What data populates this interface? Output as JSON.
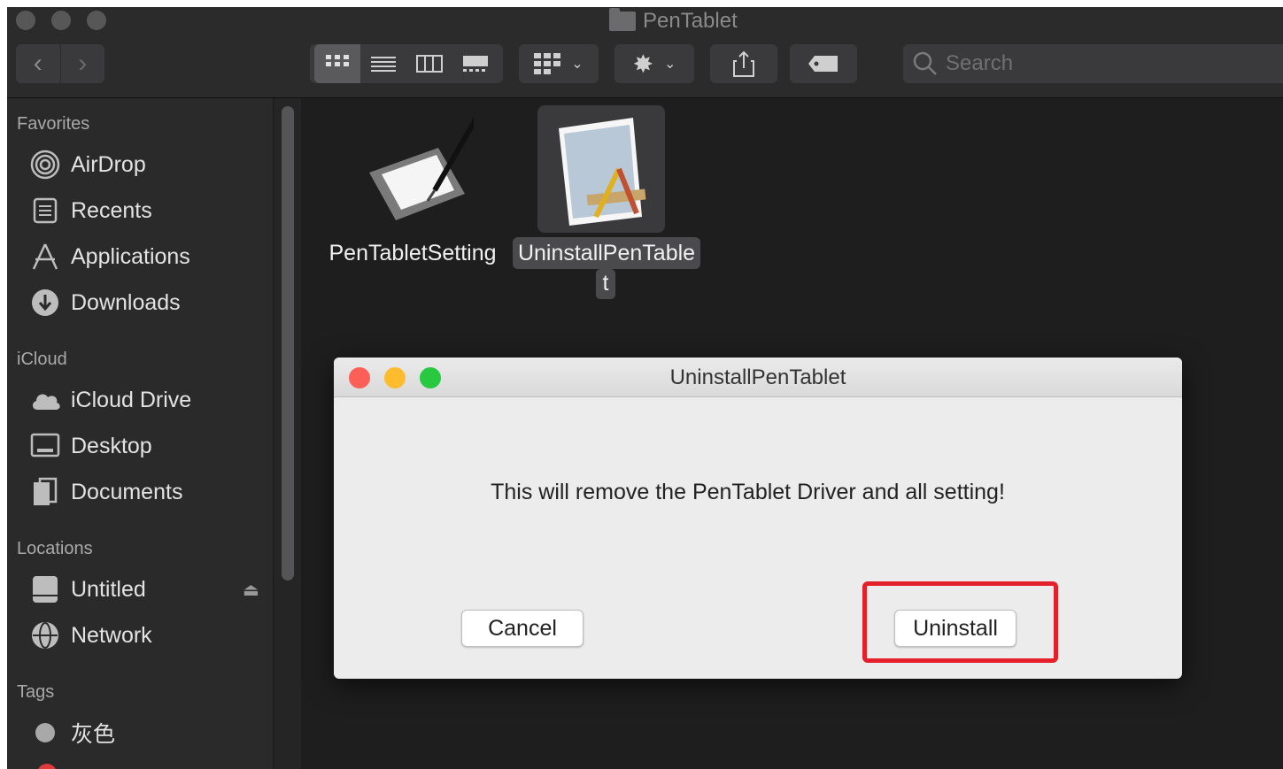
{
  "window": {
    "title": "PenTablet",
    "search_placeholder": "Search"
  },
  "sidebar": {
    "favorites_header": "Favorites",
    "favorites": [
      {
        "label": "AirDrop",
        "icon": "airdrop-icon"
      },
      {
        "label": "Recents",
        "icon": "recents-icon"
      },
      {
        "label": "Applications",
        "icon": "applications-icon"
      },
      {
        "label": "Downloads",
        "icon": "downloads-icon"
      }
    ],
    "icloud_header": "iCloud",
    "icloud": [
      {
        "label": "iCloud Drive",
        "icon": "cloud-icon"
      },
      {
        "label": "Desktop",
        "icon": "desktop-icon"
      },
      {
        "label": "Documents",
        "icon": "documents-icon"
      }
    ],
    "locations_header": "Locations",
    "locations": [
      {
        "label": "Untitled",
        "icon": "disk-icon"
      },
      {
        "label": "Network",
        "icon": "network-icon"
      }
    ],
    "tags_header": "Tags",
    "tags": [
      {
        "label": "灰色",
        "color": "#a8a8a8"
      }
    ]
  },
  "files": [
    {
      "label": "PenTabletSetting",
      "icon": "pen-tablet-icon",
      "selected": false
    },
    {
      "label_line1": "UninstallPenTable",
      "label_line2": "t",
      "icon": "uninstaller-icon",
      "selected": true
    }
  ],
  "dialog": {
    "title": "UninstallPenTablet",
    "message": "This will remove the PenTablet Driver and all setting!",
    "cancel_label": "Cancel",
    "uninstall_label": "Uninstall"
  },
  "colors": {
    "highlight": "#e4202b",
    "close": "#fc5f57",
    "minimize": "#fdbc2e",
    "zoom": "#28c840"
  }
}
